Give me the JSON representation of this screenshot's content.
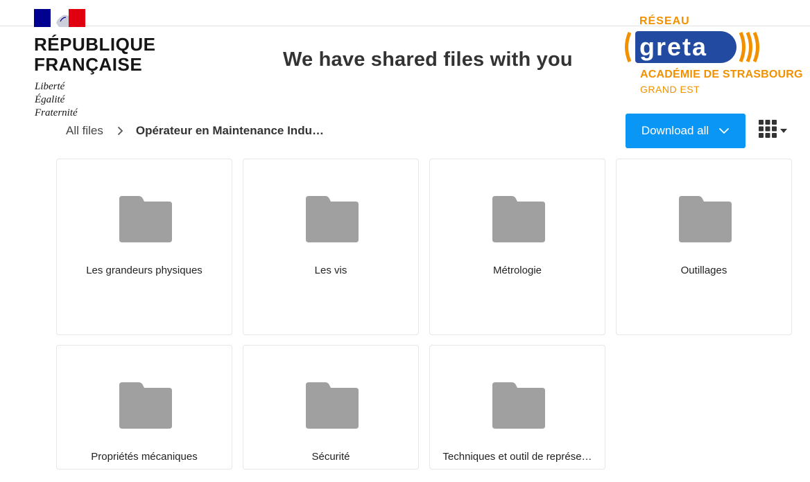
{
  "header": {
    "government_logo": {
      "name_line1": "RÉPUBLIQUE",
      "name_line2": "FRANÇAISE",
      "motto": [
        "Liberté",
        "Égalité",
        "Fraternité"
      ]
    },
    "title": "We have shared files with you",
    "greta_logo": {
      "top": "RÉSEAU",
      "wordmark": "greta",
      "academy": "ACADÉMIE DE STRASBOURG",
      "region": "GRAND EST"
    }
  },
  "breadcrumb": {
    "root": "All files",
    "current": "Opérateur en Maintenance Indu…"
  },
  "toolbar": {
    "download_label": "Download all",
    "view_icon": "grid-view-icon"
  },
  "folders": [
    {
      "name": "Les grandeurs physiques"
    },
    {
      "name": "Les vis"
    },
    {
      "name": "Métrologie"
    },
    {
      "name": "Outillages"
    },
    {
      "name": "Propriétés mécaniques"
    },
    {
      "name": "Sécurité"
    },
    {
      "name": "Techniques et outil de représe…"
    }
  ],
  "colors": {
    "accent": "#0a96f4",
    "folder_icon": "#a0a0a0",
    "greta_orange": "#f29100",
    "greta_blue": "#214aa0",
    "flag_blue": "#000091",
    "flag_red": "#e1000f"
  }
}
